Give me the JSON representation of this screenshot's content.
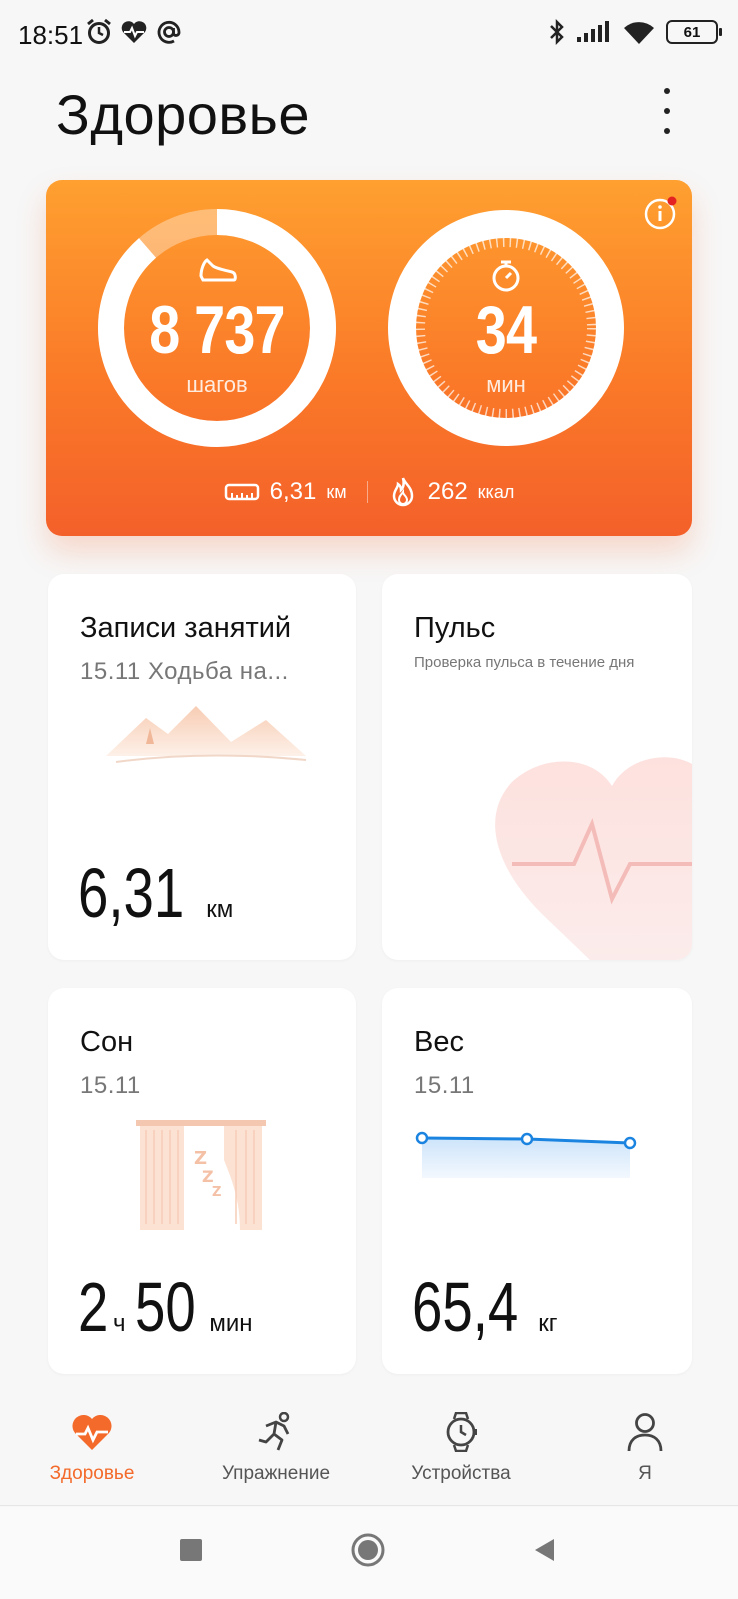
{
  "status": {
    "time": "18:51",
    "battery": "61"
  },
  "header": {
    "title": "Здоровье"
  },
  "summary": {
    "steps": "8 737",
    "steps_unit": "шагов",
    "minutes": "34",
    "minutes_unit": "мин",
    "distance": "6,31",
    "distance_unit": "км",
    "calories": "262",
    "calories_unit": "ккал"
  },
  "cards": {
    "workouts": {
      "title": "Записи занятий",
      "subtitle": "15.11 Ходьба на...",
      "value": "6,31",
      "unit": "км"
    },
    "pulse": {
      "title": "Пульс",
      "description": "Проверка пульса в течение дня"
    },
    "sleep": {
      "title": "Сон",
      "date": "15.11",
      "hours": "2",
      "hours_unit": "ч",
      "minutes": "50",
      "minutes_unit": "мин"
    },
    "weight": {
      "title": "Вес",
      "date": "15.11",
      "value": "65,4",
      "unit": "кг"
    }
  },
  "nav": {
    "items": [
      {
        "label": "Здоровье",
        "icon": "heart-pulse-icon",
        "active": true
      },
      {
        "label": "Упражнение",
        "icon": "running-icon",
        "active": false
      },
      {
        "label": "Устройства",
        "icon": "watch-icon",
        "active": false
      },
      {
        "label": "Я",
        "icon": "person-icon",
        "active": false
      }
    ]
  },
  "colors": {
    "accent": "#f36a2a",
    "card_gradient_top": "#ffa030",
    "card_gradient_bottom": "#f4602a",
    "weight_line": "#1b84e0"
  }
}
